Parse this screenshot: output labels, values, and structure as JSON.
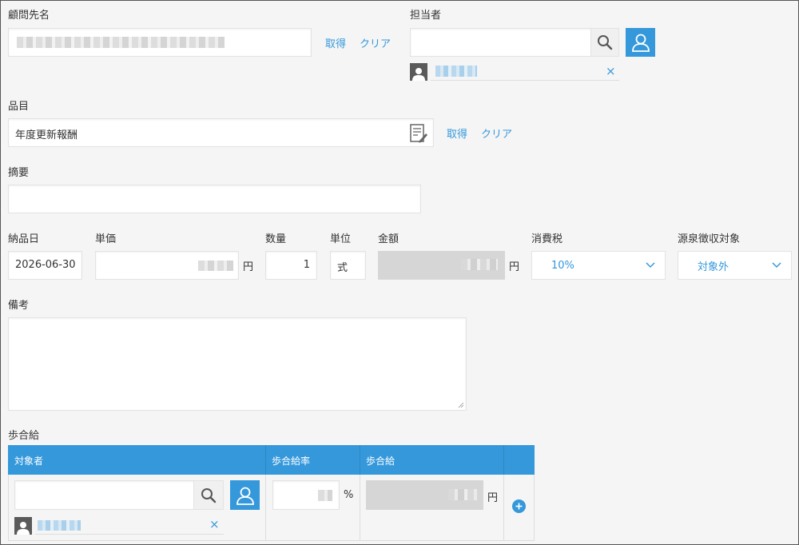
{
  "customer": {
    "label": "顧問先名",
    "get_link": "取得",
    "clear_link": "クリア"
  },
  "assignee": {
    "label": "担当者",
    "search_placeholder": "",
    "remove_symbol": "×"
  },
  "item": {
    "label": "品目",
    "value": "年度更新報酬",
    "get_link": "取得",
    "clear_link": "クリア"
  },
  "summary": {
    "label": "摘要",
    "value": ""
  },
  "delivery_date": {
    "label": "納品日",
    "value": "2026-06-30"
  },
  "unit_price": {
    "label": "単価",
    "currency": "円"
  },
  "quantity": {
    "label": "数量",
    "value": "1"
  },
  "unit": {
    "label": "単位",
    "value": "式"
  },
  "amount": {
    "label": "金額",
    "currency": "円"
  },
  "tax": {
    "label": "消費税",
    "selected": "10%"
  },
  "withholding": {
    "label": "源泉徴収対象",
    "selected": "対象外"
  },
  "remarks": {
    "label": "備考",
    "value": ""
  },
  "commission": {
    "label": "歩合給",
    "headers": {
      "target": "対象者",
      "rate": "歩合給率",
      "amount": "歩合給"
    },
    "rate_unit": "%",
    "currency": "円",
    "remove_symbol": "×"
  },
  "colors": {
    "accent": "#3498db",
    "background": "#f5f5f5",
    "readonly": "#d6d6d6"
  }
}
